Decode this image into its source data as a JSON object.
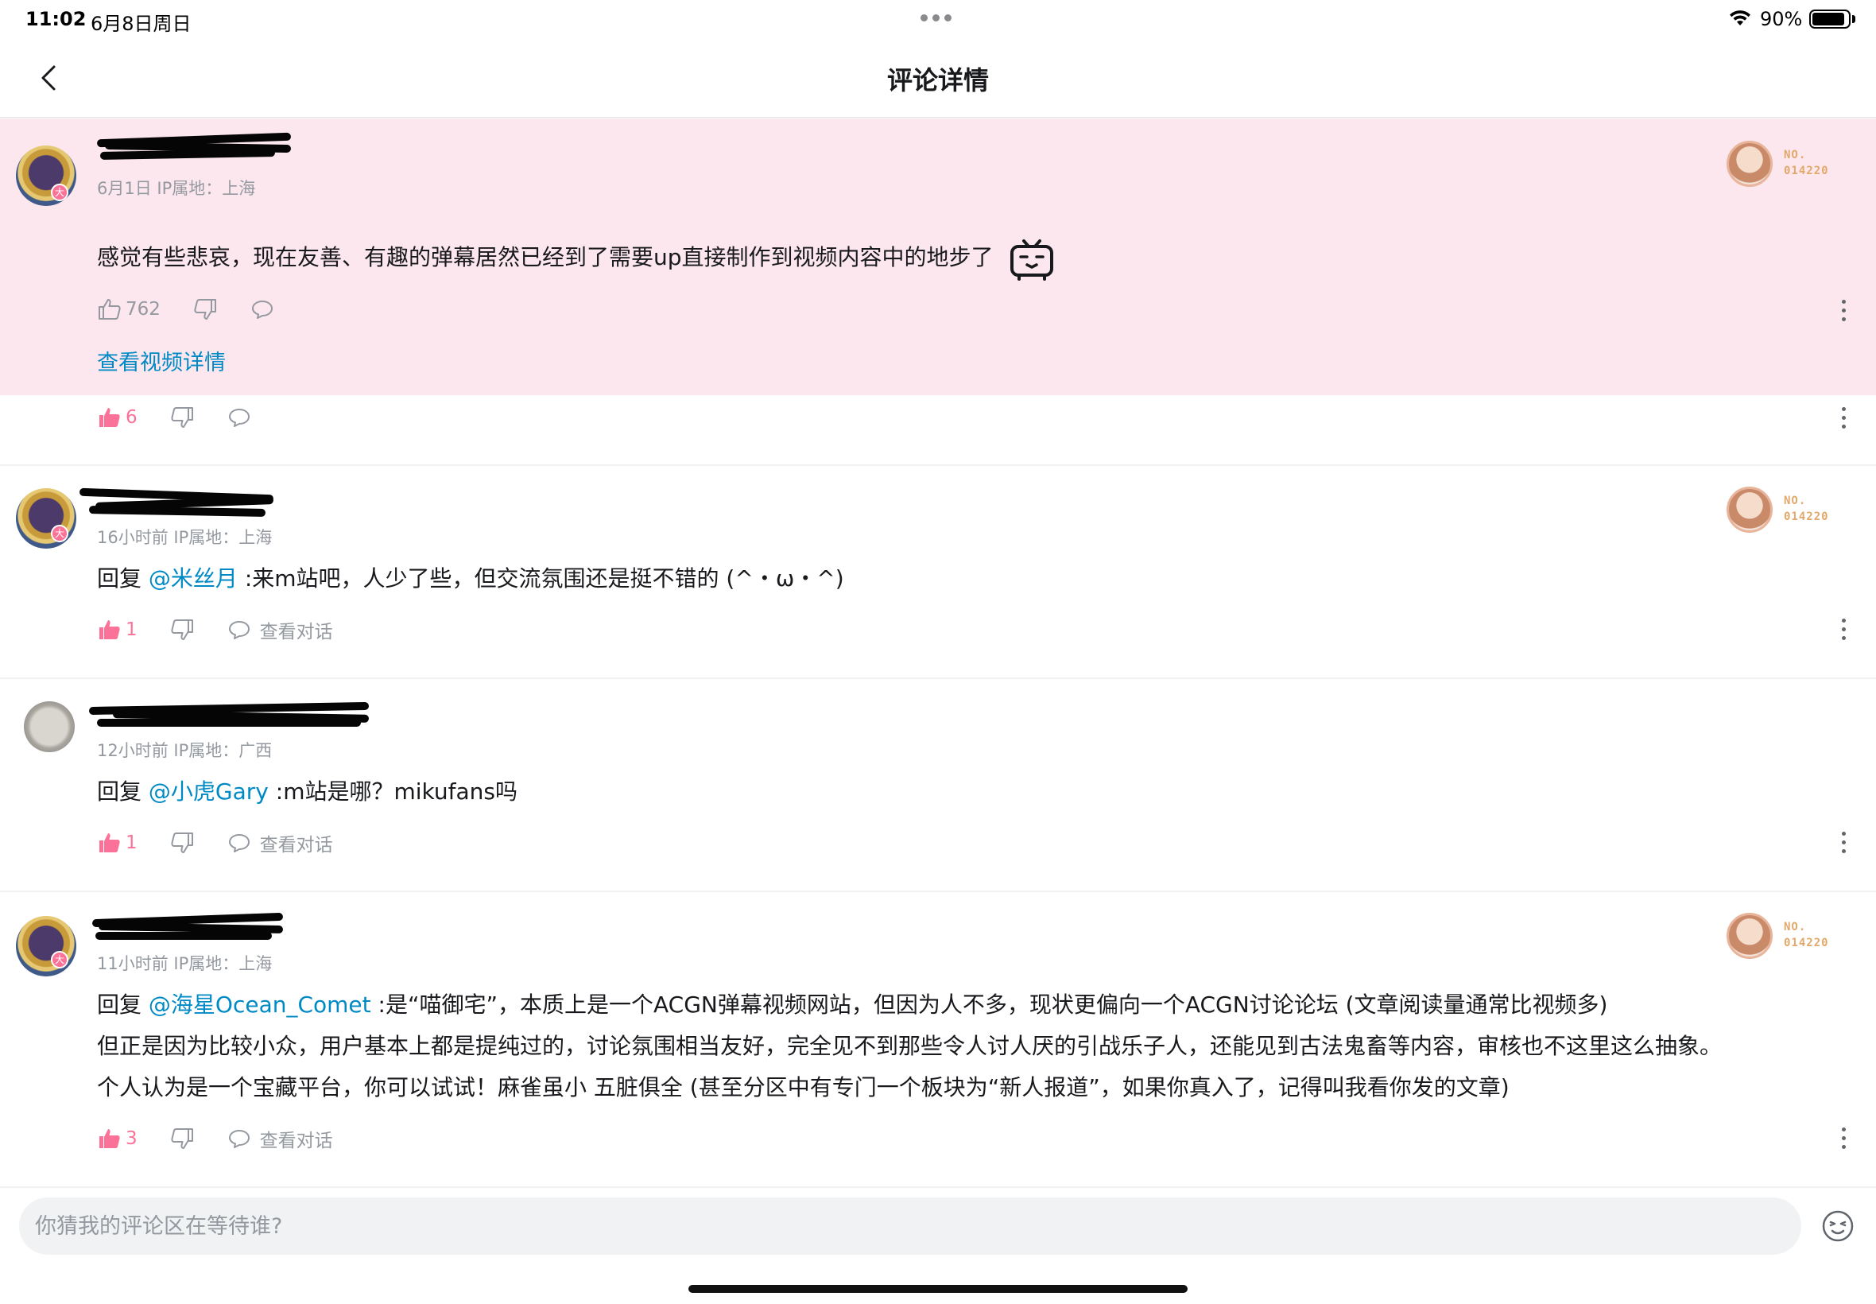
{
  "status_bar": {
    "time": "11:02",
    "date": "6月8日周日",
    "battery": "90%",
    "battery_level": 0.9
  },
  "nav": {
    "title": "评论详情"
  },
  "main_comment": {
    "meta": "6月1日  IP属地：上海",
    "text": "感觉有些悲哀，现在友善、有趣的弹幕居然已经到了需要up直接制作到视频内容中的地步了",
    "likes": "762",
    "view_video": "查看视频详情",
    "fan_no": "NO.\n014220",
    "level": "大"
  },
  "partial_reply": {
    "likes": "6"
  },
  "replies": [
    {
      "meta": "16小时前  IP属地：上海",
      "prefix": "回复 ",
      "mention": "@米丝月",
      "text": " :来m站吧，人少了些，但交流氛围还是挺不错的 (^・ω・^)",
      "likes": "1",
      "view_dialog": "查看对话",
      "fan_no": "NO.\n014220",
      "level": "大"
    },
    {
      "meta": "12小时前  IP属地：广西",
      "prefix": "回复 ",
      "mention": "@小虎Gary",
      "text": " :m站是哪？mikufans吗",
      "likes": "1",
      "view_dialog": "查看对话"
    },
    {
      "meta": "11小时前  IP属地：上海",
      "prefix": "回复 ",
      "mention": "@海星Ocean_Comet",
      "text": " :是“喵御宅”，本质上是一个ACGN弹幕视频网站，但因为人不多，现状更偏向一个ACGN讨论论坛 (文章阅读量通常比视频多)",
      "line2": "但正是因为比较小众，用户基本上都是提纯过的，讨论氛围相当友好，完全见不到那些令人讨人厌的引战乐子人，还能见到古法鬼畜等内容，审核也不这里这么抽象。",
      "line3": "个人认为是一个宝藏平台，你可以试试！麻雀虽小 五脏俱全 (甚至分区中有专门一个板块为“新人报道”，如果你真入了，记得叫我看你发的文章)",
      "likes": "3",
      "view_dialog": "查看对话",
      "fan_no": "NO.\n014220",
      "level": "大"
    }
  ],
  "input": {
    "placeholder": "你猜我的评论区在等待谁?"
  },
  "colors": {
    "accent_pink": "#fb7299",
    "link_blue": "#008ac5",
    "highlight_bg": "#fde7ee",
    "meta_gray": "#9499a0"
  },
  "icons": [
    "back-icon",
    "thumb-up-icon",
    "thumb-down-icon",
    "comment-icon",
    "more-icon",
    "emoji-icon",
    "wifi-icon",
    "battery-icon",
    "bilibili-tv-emoji-icon"
  ]
}
